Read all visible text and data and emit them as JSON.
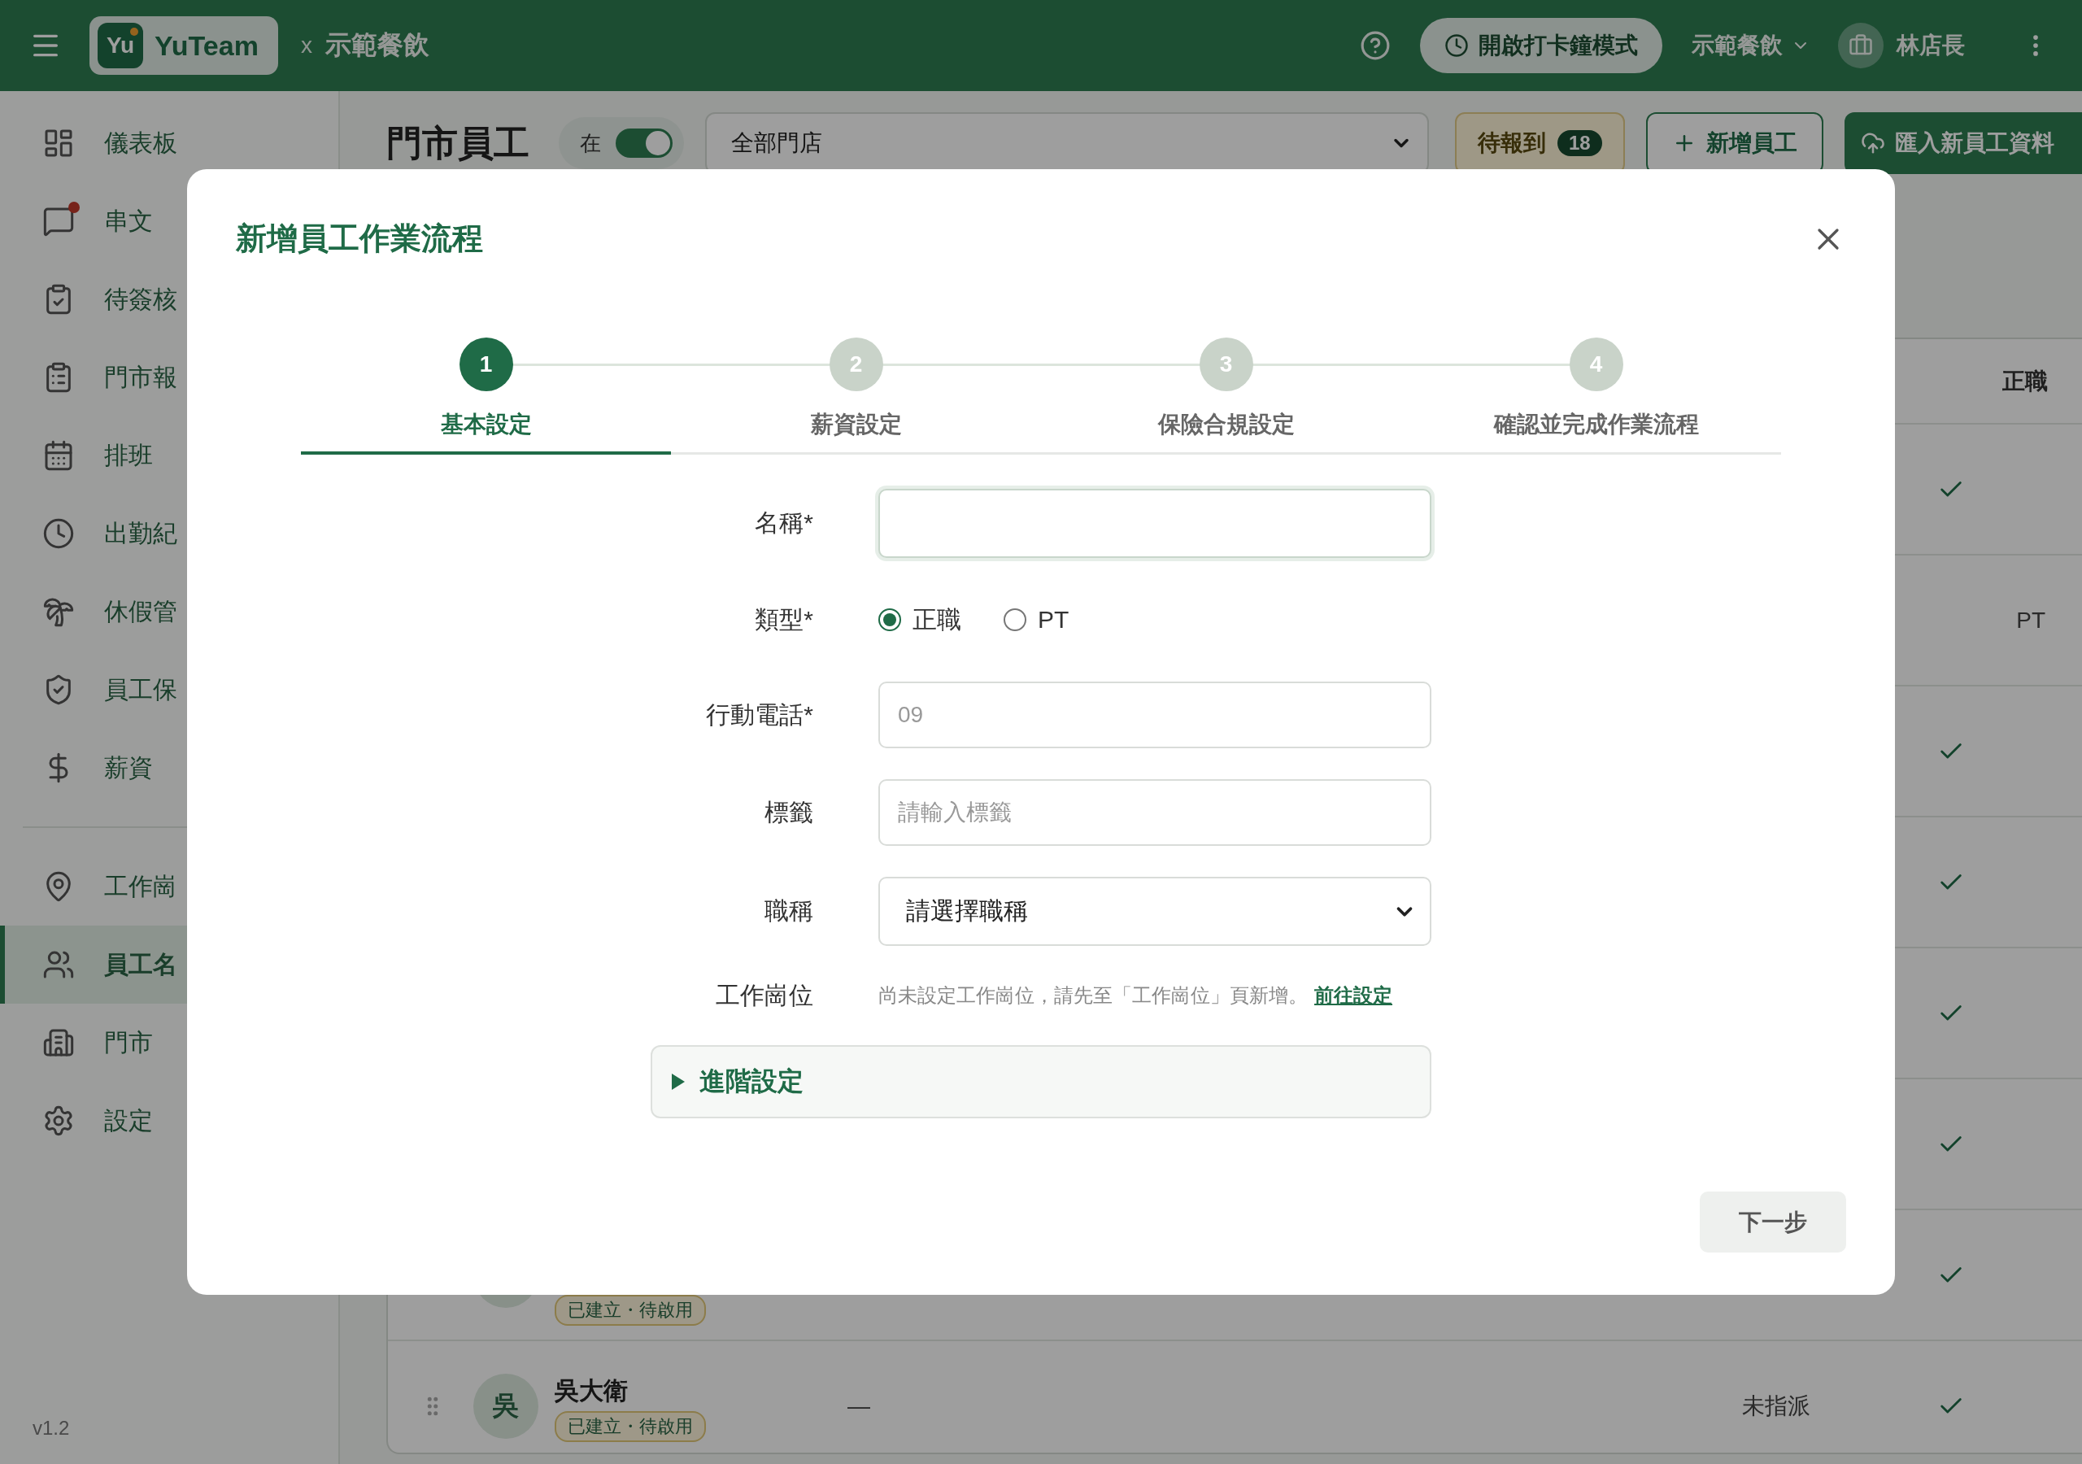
{
  "header": {
    "logo_mark": "Yu",
    "app_name": "YuTeam",
    "separator": "x",
    "org_name": "示範餐飲",
    "clock_button": "開啟打卡鐘模式",
    "org_switcher": "示範餐飲",
    "user_name": "林店長"
  },
  "sidebar": {
    "groups": [
      {
        "items": [
          {
            "label": "儀表板",
            "selected": false,
            "unread": false
          },
          {
            "label": "串文",
            "selected": false,
            "unread": true
          },
          {
            "label": "待簽核",
            "selected": false,
            "unread": false
          },
          {
            "label": "門市報",
            "selected": false,
            "unread": false
          },
          {
            "label": "排班",
            "selected": false,
            "unread": false
          },
          {
            "label": "出勤紀",
            "selected": false,
            "unread": false
          },
          {
            "label": "休假管",
            "selected": false,
            "unread": false
          },
          {
            "label": "員工保",
            "selected": false,
            "unread": false
          },
          {
            "label": "薪資",
            "selected": false,
            "unread": false
          }
        ]
      },
      {
        "items": [
          {
            "label": "工作崗",
            "selected": false,
            "unread": false
          },
          {
            "label": "員工名",
            "selected": true,
            "unread": false
          },
          {
            "label": "門市",
            "selected": false,
            "unread": false
          },
          {
            "label": "設定",
            "selected": false,
            "unread": false
          }
        ]
      }
    ],
    "version": "v1.2"
  },
  "main": {
    "title": "門市員工",
    "status_toggle": {
      "label": "在",
      "on": true
    },
    "store_select": {
      "value": "全部門店"
    },
    "pending_button": {
      "label": "待報到",
      "count": "18"
    },
    "add_button": "新增員工",
    "import_button": "匯入新員工資料",
    "table": {
      "type_column": "正職",
      "rows": [
        {
          "full_time": true
        },
        {
          "full_time": false,
          "type": "PT"
        },
        {
          "full_time": true
        },
        {
          "full_time": true
        },
        {
          "full_time": true
        },
        {
          "full_time": true
        },
        {
          "tag": "已建立・待啟用",
          "full_time": true
        },
        {
          "avatar": "吳",
          "name": "吳大衛",
          "tag": "已建立・待啟用",
          "phone": "—",
          "position": "未指派",
          "full_time": true
        }
      ]
    }
  },
  "modal": {
    "title": "新增員工作業流程",
    "steps": [
      {
        "number": "1",
        "label": "基本設定",
        "selected": true
      },
      {
        "number": "2",
        "label": "薪資設定",
        "selected": false
      },
      {
        "number": "3",
        "label": "保險合規設定",
        "selected": false
      },
      {
        "number": "4",
        "label": "確認並完成作業流程",
        "selected": false
      }
    ],
    "fields": [
      {
        "kind": "text",
        "label": "名稱*",
        "focused": true
      },
      {
        "kind": "radio",
        "label": "類型*",
        "options": [
          {
            "label": "正職",
            "selected": true
          },
          {
            "label": "PT",
            "selected": false
          }
        ]
      },
      {
        "kind": "text",
        "label": "行動電話*",
        "placeholder": "09",
        "focused": false
      },
      {
        "kind": "text",
        "label": "標籤",
        "placeholder": "請輸入標籤",
        "focused": false
      },
      {
        "kind": "select",
        "label": "職稱",
        "value": "請選擇職稱"
      },
      {
        "kind": "note",
        "label": "工作崗位",
        "text": "尚未設定工作崗位，請先至「工作崗位」頁新增。",
        "link": "前往設定"
      }
    ],
    "advanced": {
      "label": "進階設定",
      "expanded": false
    },
    "next_button": "下一步"
  }
}
